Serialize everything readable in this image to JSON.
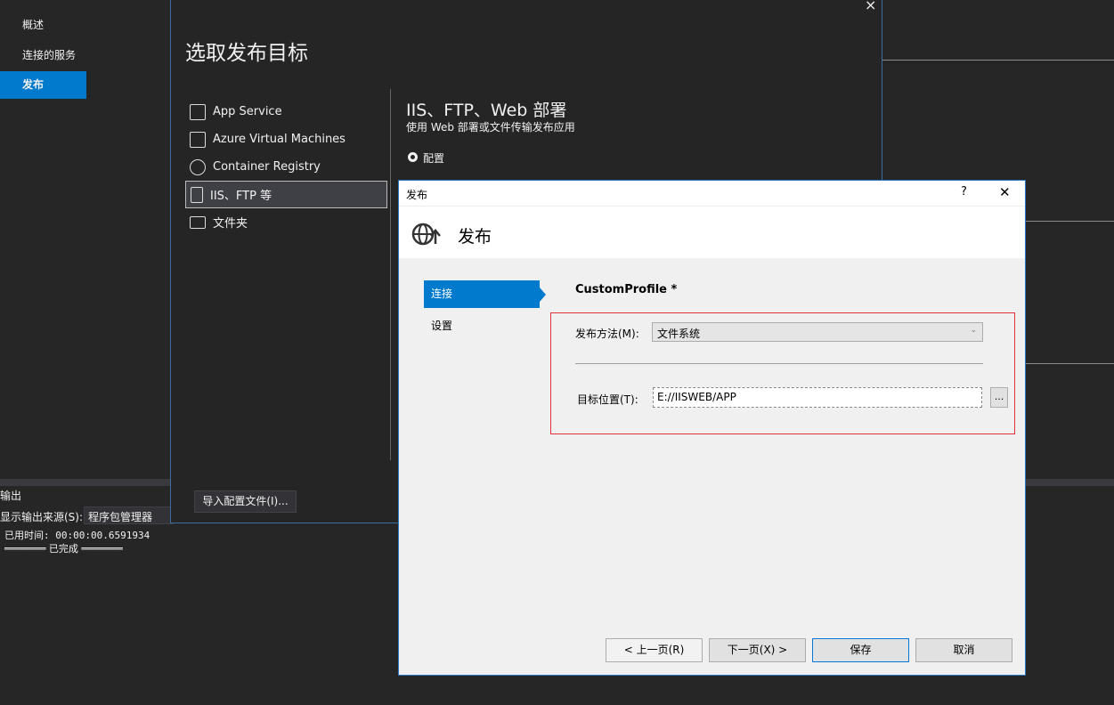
{
  "sidebar": {
    "items": [
      {
        "label": "概述"
      },
      {
        "label": "连接的服务"
      },
      {
        "label": "发布",
        "selected": true
      }
    ]
  },
  "target_dialog": {
    "title": "选取发布目标",
    "close": "×",
    "targets": [
      {
        "label": "App Service",
        "icon": "app-service-icon"
      },
      {
        "label": "Azure Virtual Machines",
        "icon": "vm-icon"
      },
      {
        "label": "Container Registry",
        "icon": "container-registry-icon"
      },
      {
        "label": "IIS、FTP 等",
        "icon": "file-icon",
        "selected": true
      },
      {
        "label": "文件夹",
        "icon": "folder-icon"
      }
    ],
    "detail": {
      "title": "IIS、FTP、Web 部署",
      "subtitle": "使用 Web 部署或文件传输发布应用",
      "radio_label": "配置"
    },
    "import_button": "导入配置文件(I)..."
  },
  "output": {
    "title": "输出",
    "source_label": "显示输出来源(S):",
    "source_value": "程序包管理器",
    "elapsed": "已用时间: 00:00:00.6591934",
    "done": "═══════ 已完成 ═══════"
  },
  "publish_dialog": {
    "window_title": "发布",
    "help": "?",
    "close": "✕",
    "header_title": "发布",
    "steps": [
      {
        "label": "连接",
        "selected": true
      },
      {
        "label": "设置"
      }
    ],
    "profile_name": "CustomProfile *",
    "method_label": "发布方法(M):",
    "method_value": "文件系统",
    "target_label": "目标位置(T):",
    "target_value": "E://IISWEB/APP",
    "browse": "...",
    "buttons": {
      "prev": "< 上一页(R)",
      "next": "下一页(X) >",
      "save": "保存",
      "cancel": "取消"
    },
    "accent": "#007acc",
    "highlight_border": "#e0303a"
  }
}
